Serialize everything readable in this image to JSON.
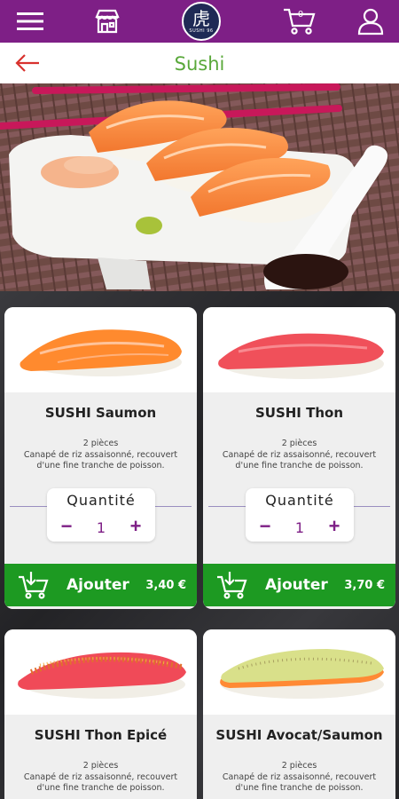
{
  "header": {
    "menu_icon": "hamburger-menu-icon",
    "store_icon": "storefront-icon",
    "logo": {
      "glyph": "虎",
      "text": "SUSHI 96"
    },
    "cart": {
      "icon": "cart-icon",
      "count": "0"
    },
    "user_icon": "user-icon",
    "color": "#7e1f86"
  },
  "titlebar": {
    "back_icon": "arrow-left-icon",
    "title": "Sushi",
    "title_color": "#59a83a"
  },
  "hero": {
    "image": "sushi-platter-photo"
  },
  "products": [
    {
      "name": "SUSHI Saumon",
      "pieces": "2 pièces",
      "desc_line1": "Canapé de riz assaisonné, recouvert",
      "desc_line2": "d'une fine tranche de poisson.",
      "qty_label": "Quantité",
      "qty": "1",
      "add_label": "Ajouter",
      "price": "3,40 €"
    },
    {
      "name": "SUSHI Thon",
      "pieces": "2 pièces",
      "desc_line1": "Canapé de riz assaisonné, recouvert",
      "desc_line2": "d'une fine tranche de poisson.",
      "qty_label": "Quantité",
      "qty": "1",
      "add_label": "Ajouter",
      "price": "3,70 €"
    },
    {
      "name": "SUSHI Thon Epicé",
      "pieces": "2 pièces",
      "desc_line1": "Canapé de riz assaisonné, recouvert",
      "desc_line2": "d'une fine tranche de poisson."
    },
    {
      "name": "SUSHI Avocat/Saumon",
      "pieces": "2 pièces",
      "desc_line1": "Canapé de riz assaisonné, recouvert",
      "desc_line2": "d'une fine tranche de poisson."
    }
  ],
  "colors": {
    "accent_purple": "#7e1f86",
    "add_green": "#1d9a22",
    "title_green": "#59a83a"
  }
}
